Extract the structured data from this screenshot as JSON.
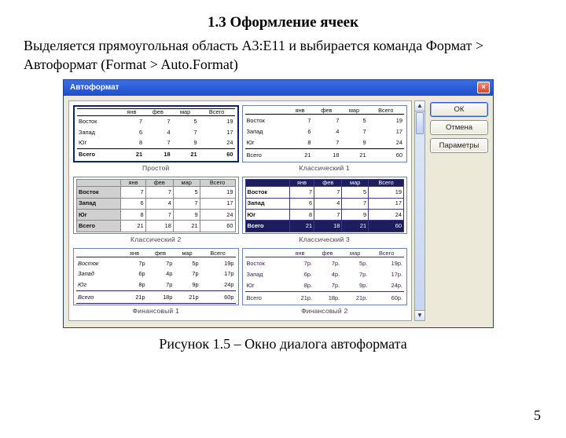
{
  "heading": "1.3 Оформление ячеек",
  "paragraph": "Выделяется прямоугольная область А3:Е11 и выбирается команда Формат > Автоформат (Format > Auto.Format)",
  "caption": "Рисунок 1.5 –  Окно диалога автоформата",
  "page_number": "5",
  "dialog": {
    "title": "Автоформат",
    "close": "×",
    "buttons": {
      "ok": "ОК",
      "cancel": "Отмена",
      "options": "Параметры"
    },
    "scroll": {
      "up": "▲",
      "down": "▼"
    },
    "common": {
      "cols": [
        "янв",
        "фев",
        "мар",
        "Всего"
      ],
      "rows": [
        "Восток",
        "Запад",
        "Юг",
        "Всего"
      ],
      "data": [
        [
          7,
          7,
          5,
          19
        ],
        [
          6,
          4,
          7,
          17
        ],
        [
          8,
          7,
          9,
          24
        ],
        [
          21,
          18,
          21,
          60
        ]
      ]
    },
    "variants": [
      {
        "label": "Простой",
        "style": "v0"
      },
      {
        "label": "Классический 1",
        "style": "v1"
      },
      {
        "label": "Классический 2",
        "style": "v2"
      },
      {
        "label": "Классический 3",
        "style": "v3"
      },
      {
        "label": "Финансовый 1",
        "style": "v4",
        "currency": "р"
      },
      {
        "label": "Финансовый 2",
        "style": "v5",
        "currency": "р."
      }
    ]
  }
}
